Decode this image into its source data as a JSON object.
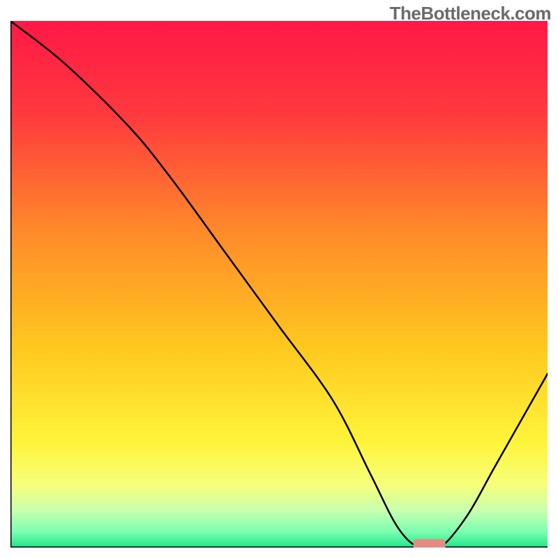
{
  "watermark": "TheBottleneck.com",
  "chart_data": {
    "type": "line",
    "title": "",
    "xlabel": "",
    "ylabel": "",
    "xlim": [
      0,
      100
    ],
    "ylim": [
      0,
      100
    ],
    "grid": false,
    "legend": false,
    "series": [
      {
        "name": "bottleneck-curve",
        "x": [
          0,
          10,
          22,
          30,
          40,
          50,
          60,
          67,
          72,
          76,
          80,
          85,
          90,
          95,
          100
        ],
        "y": [
          100,
          92,
          80,
          70,
          56,
          42,
          28,
          14,
          4,
          0,
          0,
          6,
          15,
          24,
          33
        ],
        "color": "#000000",
        "width": 2
      }
    ],
    "marker": {
      "name": "optimal-range",
      "x_start": 75,
      "x_end": 81,
      "y": 0.6,
      "color": "#e58b83",
      "thickness": 2
    },
    "background_gradient": {
      "top_to_bottom": [
        {
          "stop": 0.0,
          "color": "#ff1846"
        },
        {
          "stop": 0.18,
          "color": "#ff3a3e"
        },
        {
          "stop": 0.4,
          "color": "#ff8a2a"
        },
        {
          "stop": 0.62,
          "color": "#ffc81f"
        },
        {
          "stop": 0.8,
          "color": "#fff43a"
        },
        {
          "stop": 0.88,
          "color": "#f7ff7a"
        },
        {
          "stop": 0.93,
          "color": "#c8ffb0"
        },
        {
          "stop": 0.97,
          "color": "#7bffb0"
        },
        {
          "stop": 1.0,
          "color": "#21e58b"
        }
      ]
    }
  }
}
